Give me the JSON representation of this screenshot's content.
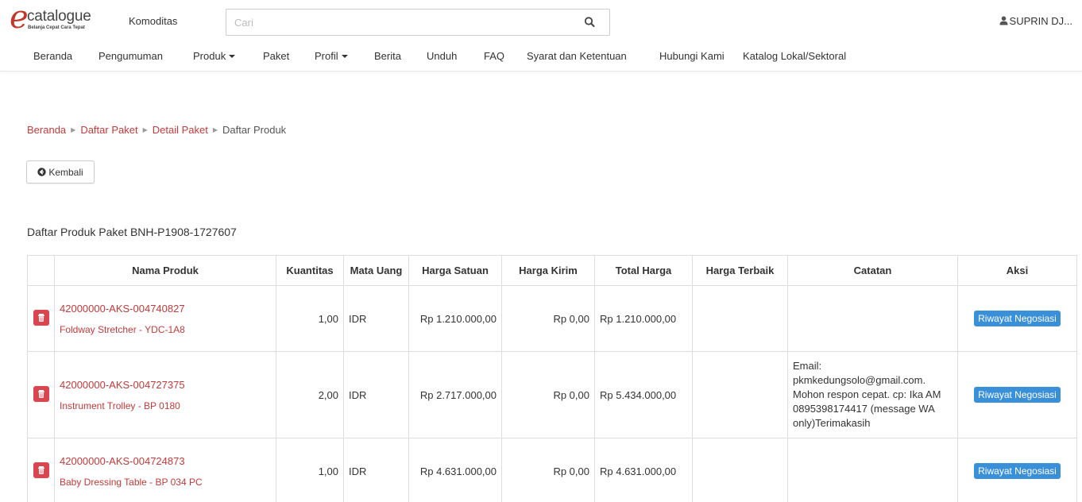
{
  "header": {
    "logo_word": "catalogue",
    "logo_tagline": "Belanja Cepat Cara Tepat",
    "komoditas_label": "Komoditas",
    "search_placeholder": "Cari",
    "user_name": "SUPRIN DJ..."
  },
  "nav": {
    "items": [
      {
        "label": "Beranda"
      },
      {
        "label": "Pengumuman"
      },
      {
        "label": "Produk"
      },
      {
        "label": "Paket"
      },
      {
        "label": "Profil"
      },
      {
        "label": "Berita"
      },
      {
        "label": "Unduh"
      },
      {
        "label": "FAQ"
      },
      {
        "label": "Syarat dan Ketentuan"
      },
      {
        "label": "Hubungi Kami"
      },
      {
        "label": "Katalog Lokal/Sektoral"
      }
    ]
  },
  "breadcrumb": {
    "items": [
      "Beranda",
      "Daftar Paket",
      "Detail Paket"
    ],
    "current": "Daftar Produk"
  },
  "back_button_label": "Kembali",
  "section_title": "Daftar Produk Paket BNH-P1908-1727607",
  "table": {
    "headers": [
      "Nama Produk",
      "Kuantitas",
      "Mata Uang",
      "Harga Satuan",
      "Harga Kirim",
      "Total Harga",
      "Harga Terbaik",
      "Catatan",
      "Aksi"
    ],
    "rows": [
      {
        "code": "42000000-AKS-004740827",
        "name": "Foldway Stretcher - YDC-1A8",
        "qty": "1,00",
        "currency": "IDR",
        "unit_price": "Rp 1.210.000,00",
        "shipping": "Rp 0,00",
        "total": "Rp 1.210.000,00",
        "best_price": "",
        "note": "",
        "action": "Riwayat Negosiasi"
      },
      {
        "code": "42000000-AKS-004727375",
        "name": "Instrument Trolley - BP 0180",
        "qty": "2,00",
        "currency": "IDR",
        "unit_price": "Rp 2.717.000,00",
        "shipping": "Rp 0,00",
        "total": "Rp 5.434.000,00",
        "best_price": "",
        "note": "Email: pkmkedungsolo@gmail.com. Mohon respon cepat. cp: Ika AM 0895398174417 (message WA only)Terimakasih",
        "action": "Riwayat Negosiasi"
      },
      {
        "code": "42000000-AKS-004724873",
        "name": "Baby Dressing Table - BP 034 PC",
        "qty": "1,00",
        "currency": "IDR",
        "unit_price": "Rp 4.631.000,00",
        "shipping": "Rp 0,00",
        "total": "Rp 4.631.000,00",
        "best_price": "",
        "note": "",
        "action": "Riwayat Negosiasi"
      }
    ]
  },
  "colors": {
    "brand_red": "#c43a3a",
    "delete_red": "#d9464f",
    "action_blue": "#3a8fd9"
  }
}
